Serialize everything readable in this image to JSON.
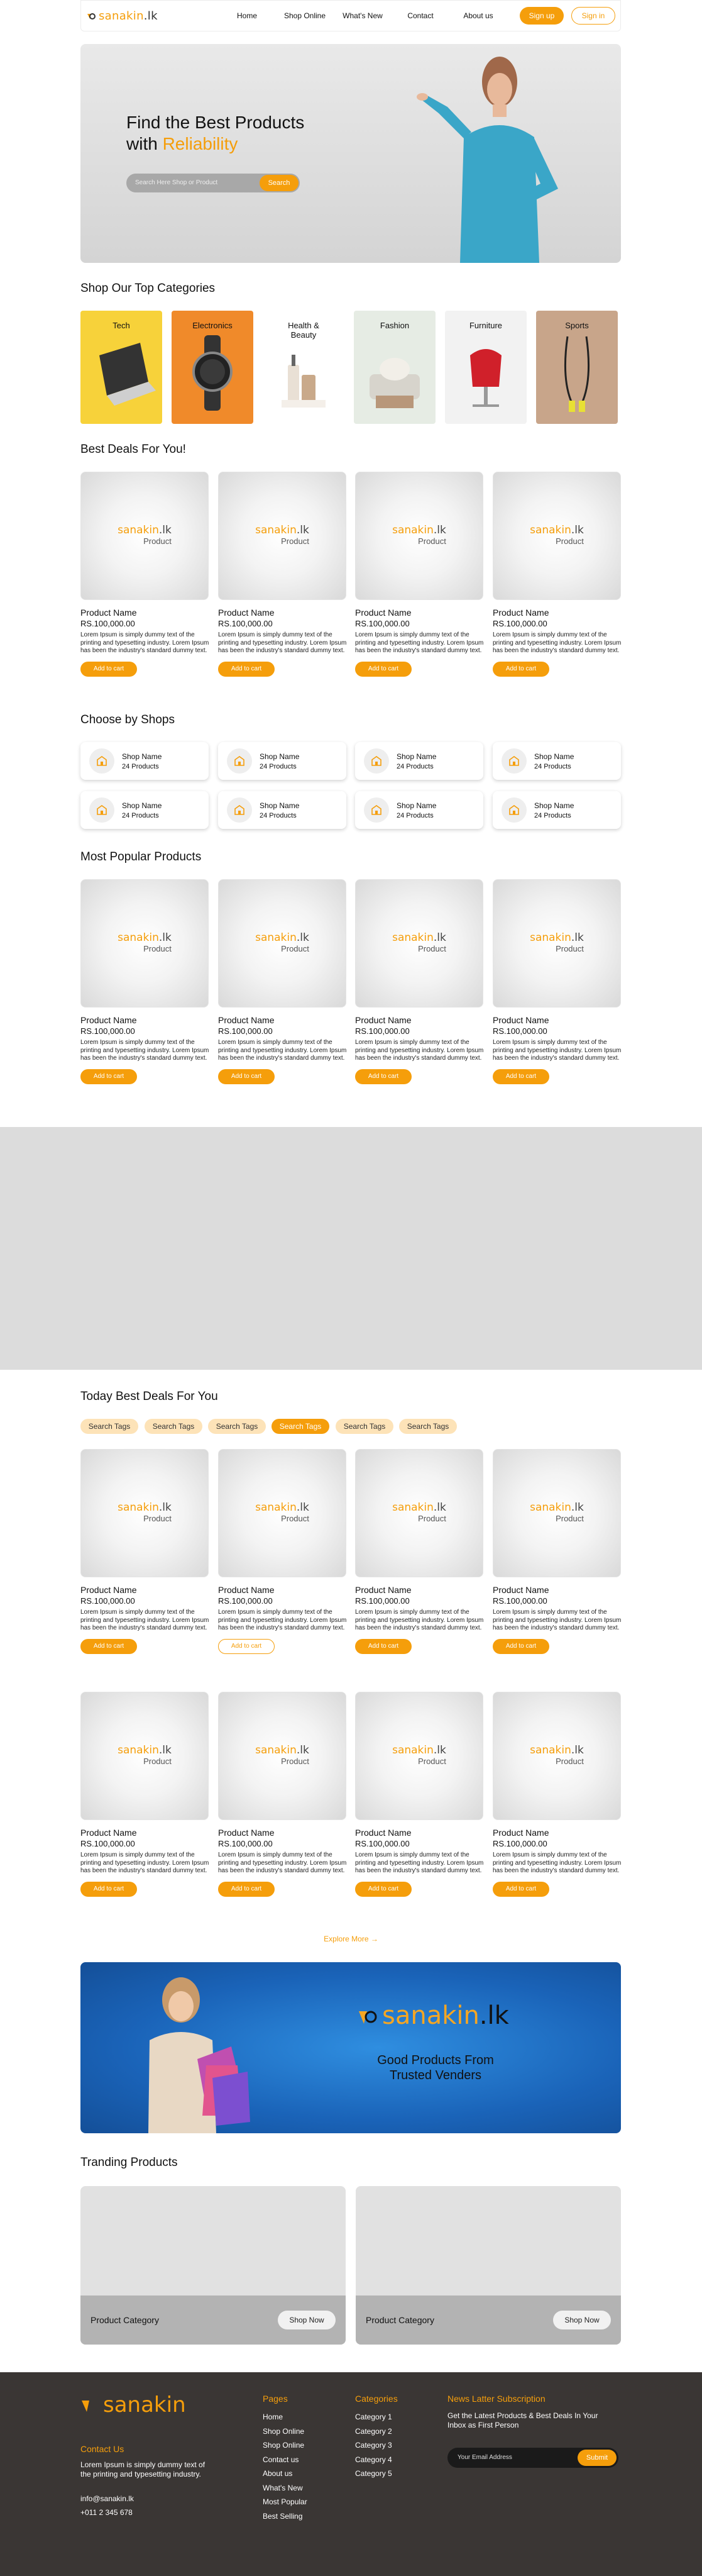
{
  "nav": {
    "logo_main": "sanakin",
    "logo_suffix": ".lk",
    "links": [
      "Home",
      "Shop Online",
      "What's New",
      "Contact",
      "About us"
    ],
    "signup": "Sign up",
    "signin": "Sign in"
  },
  "hero": {
    "title_line1": "Find the Best Products",
    "title_prefix": "with ",
    "title_highlight": "Reliability",
    "search_placeholder": "Search Here Shop or Product",
    "search_button": "Search"
  },
  "categories": {
    "title": "Shop Our Top Categories",
    "items": [
      {
        "label": "Tech",
        "bg": "#f7d23a"
      },
      {
        "label": "Electronics",
        "bg": "#f08a2a"
      },
      {
        "label": "Health & Beauty",
        "bg": "#ffffff"
      },
      {
        "label": "Fashion",
        "bg": "#e6ece4"
      },
      {
        "label": "Furniture",
        "bg": "#f2f2f2"
      },
      {
        "label": "Sports",
        "bg": "#c8a58a"
      }
    ]
  },
  "product": {
    "logo_main": "sanakin",
    "logo_suffix": ".lk",
    "logo_sub": "Product",
    "name": "Product Name",
    "price": "RS.100,000.00",
    "desc": "Lorem Ipsum is simply dummy text of the printing and typesetting industry. Lorem Ipsum has been the industry's standard dummy text.",
    "add": "Add to cart"
  },
  "deals": {
    "title": "Best Deals For You!"
  },
  "shops": {
    "title": "Choose by Shops",
    "name": "Shop Name",
    "count": "24 Products"
  },
  "popular": {
    "title": "Most Popular Products"
  },
  "today": {
    "title": "Today Best Deals For You",
    "tags": [
      "Search Tags",
      "Search Tags",
      "Search Tags",
      "Search Tags",
      "Search Tags",
      "Search Tags"
    ],
    "explore": "Explore More →"
  },
  "banner": {
    "logo_main": "sanakin",
    "logo_suffix": ".lk",
    "tagline1": "Good Products From",
    "tagline2": "Trusted Venders"
  },
  "trending": {
    "title": "Tranding Products",
    "items": [
      {
        "label": "Product Category",
        "button": "Shop Now"
      },
      {
        "label": "Product Category",
        "button": "Shop Now"
      }
    ]
  },
  "footer": {
    "logo": "sanakin",
    "contact_title": "Contact Us",
    "contact_text": "Lorem Ipsum is simply dummy text of the printing and typesetting industry.",
    "email": "info@sanakin.lk",
    "phone": "+011 2 345 678",
    "pages_title": "Pages",
    "pages": [
      "Home",
      "Shop Online",
      "Shop Online",
      "Contact us",
      "About us",
      "What's New",
      "Most Popular",
      "Best Selling"
    ],
    "cat_title": "Categories",
    "cats": [
      "Category 1",
      "Category 2",
      "Category 3",
      "Category 4",
      "Category 5"
    ],
    "news_title": "News Latter Subscription",
    "news_text": "Get the Latest Products & Best Deals In Your Inbox as First Person",
    "news_placeholder": "Your Email Address",
    "news_button": "Submit"
  },
  "colors": {
    "accent": "#f59e0b",
    "footer_bg": "#3a3634",
    "banner_bg": "#1f6fc4"
  }
}
